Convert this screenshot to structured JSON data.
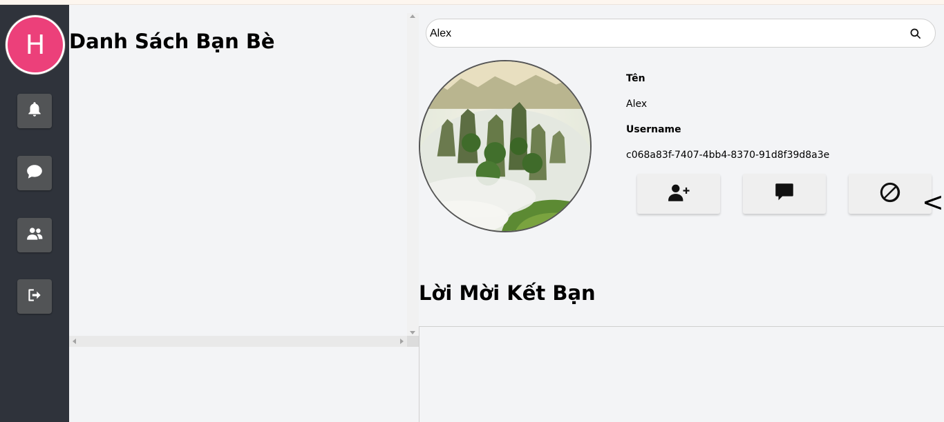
{
  "sidebar": {
    "avatar_initial": "H",
    "avatar_color": "#ec407a",
    "buttons": [
      {
        "icon": "bell-icon"
      },
      {
        "icon": "chat-icon"
      },
      {
        "icon": "users-icon"
      },
      {
        "icon": "logout-icon"
      }
    ]
  },
  "friends_panel": {
    "title": "Danh Sách Bạn Bè"
  },
  "search": {
    "value": "Alex",
    "icon": "search-icon"
  },
  "profile": {
    "name_label": "Tên",
    "name": "Alex",
    "username_label": "Username",
    "username": "c068a83f-7407-4bb4-8370-91d8f39d8a3e",
    "actions": [
      {
        "icon": "add-friend-icon"
      },
      {
        "icon": "message-icon"
      },
      {
        "icon": "block-icon"
      }
    ],
    "collapse_glyph": "<"
  },
  "requests": {
    "title": "Lời Mời Kết Bạn"
  }
}
